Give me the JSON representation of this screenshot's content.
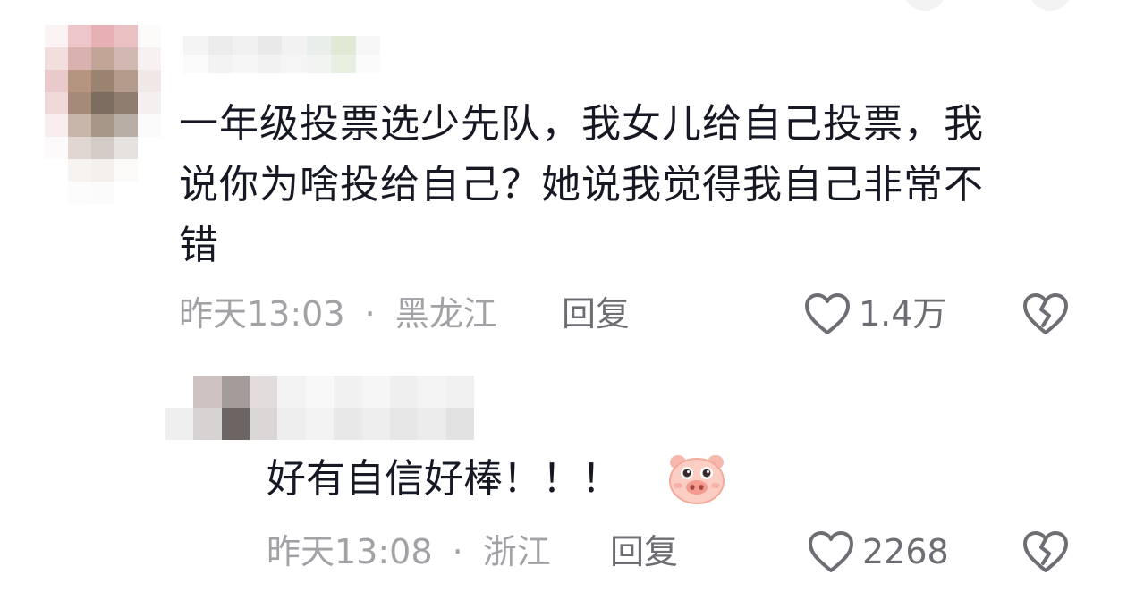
{
  "colors": {
    "text": "#161823",
    "meta": "#a1a2a6",
    "action": "#6d6e73",
    "background": "#ffffff"
  },
  "comment": {
    "text_line1": "一年级投票选少先队，我女儿给自己投票，我",
    "text_line2": "说你为啥投给自己？她说我觉得我自己非常不",
    "text_line3": "错",
    "time": "昨天13:03",
    "separator": "·",
    "location": "黑龙江",
    "reply_label": "回复",
    "like_count": "1.4万",
    "like_icon": "heart-outline-icon",
    "dislike_icon": "broken-heart-icon"
  },
  "reply": {
    "text": "好有自信好棒！！！",
    "emoji_icon": "pig-face-emoji",
    "time": "昨天13:08",
    "separator": "·",
    "location": "浙江",
    "reply_label": "回复",
    "like_count": "2268",
    "like_icon": "heart-outline-icon",
    "dislike_icon": "broken-heart-icon"
  }
}
